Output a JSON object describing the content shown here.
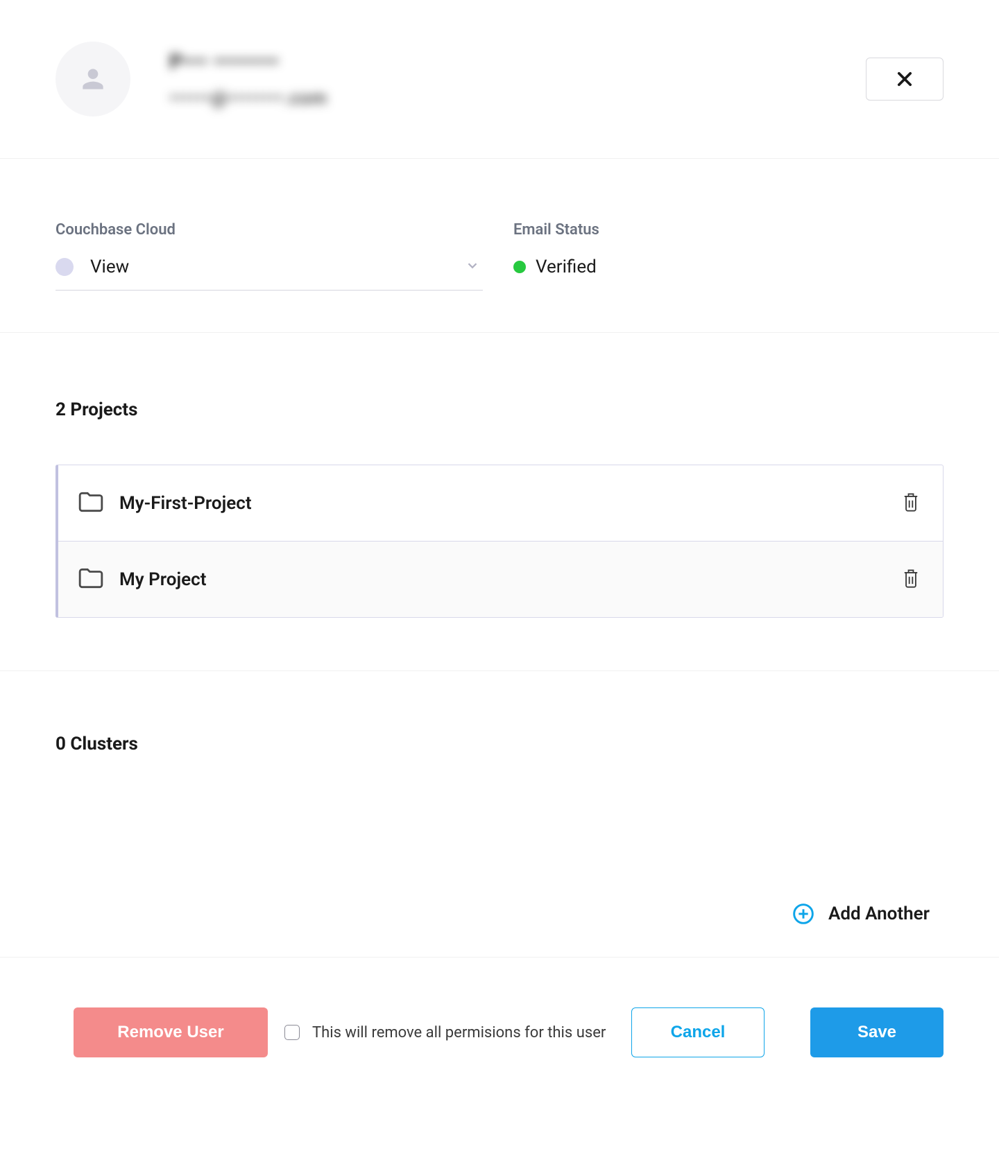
{
  "header": {
    "user_name": "P••• ••••••••",
    "user_email": "••••••@••••••••.com"
  },
  "form": {
    "cloud_label": "Couchbase Cloud",
    "cloud_value": "View",
    "email_status_label": "Email Status",
    "email_status_value": "Verified",
    "status_color": "#27c93f"
  },
  "projects": {
    "heading": "2 Projects",
    "items": [
      {
        "name": "My-First-Project"
      },
      {
        "name": "My Project"
      }
    ]
  },
  "clusters": {
    "heading": "0 Clusters",
    "add_label": "Add Another"
  },
  "footer": {
    "remove_label": "Remove User",
    "remove_note": "This will remove all permisions for this user",
    "cancel_label": "Cancel",
    "save_label": "Save"
  }
}
